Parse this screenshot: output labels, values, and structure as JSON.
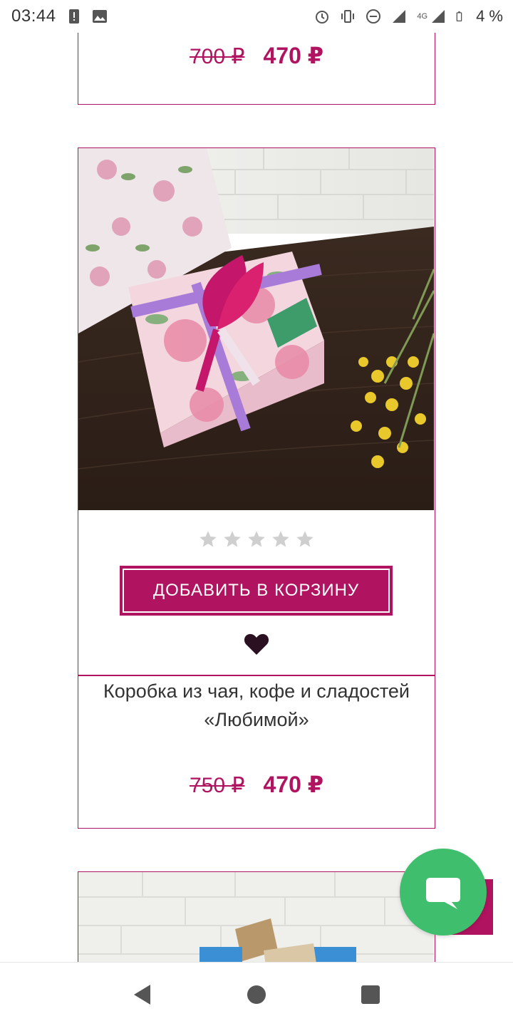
{
  "status_bar": {
    "time": "03:44",
    "battery": "4 %",
    "network": "4G",
    "icons": [
      "alert-icon",
      "image-icon",
      "alarm-icon",
      "vibrate-icon",
      "dnd-icon",
      "signal-icon",
      "battery-icon"
    ]
  },
  "previous_product": {
    "old_price": "700 ₽",
    "new_price": "470 ₽"
  },
  "product": {
    "image_alt": "Подарочная коробка",
    "rating": 0,
    "rating_max": 5,
    "add_to_cart_label": "ДОБАВИТЬ В КОРЗИНУ",
    "name": "Коробка из чая, кофе и сладостей «Любимой»",
    "old_price": "750 ₽",
    "new_price": "470 ₽"
  },
  "colors": {
    "accent": "#b0135f",
    "chat": "#3fbf6e",
    "star_empty": "#cfcfcf",
    "heart": "#2a1020"
  },
  "nav_bar": {
    "icons": [
      "back-icon",
      "home-icon",
      "recents-icon"
    ]
  }
}
